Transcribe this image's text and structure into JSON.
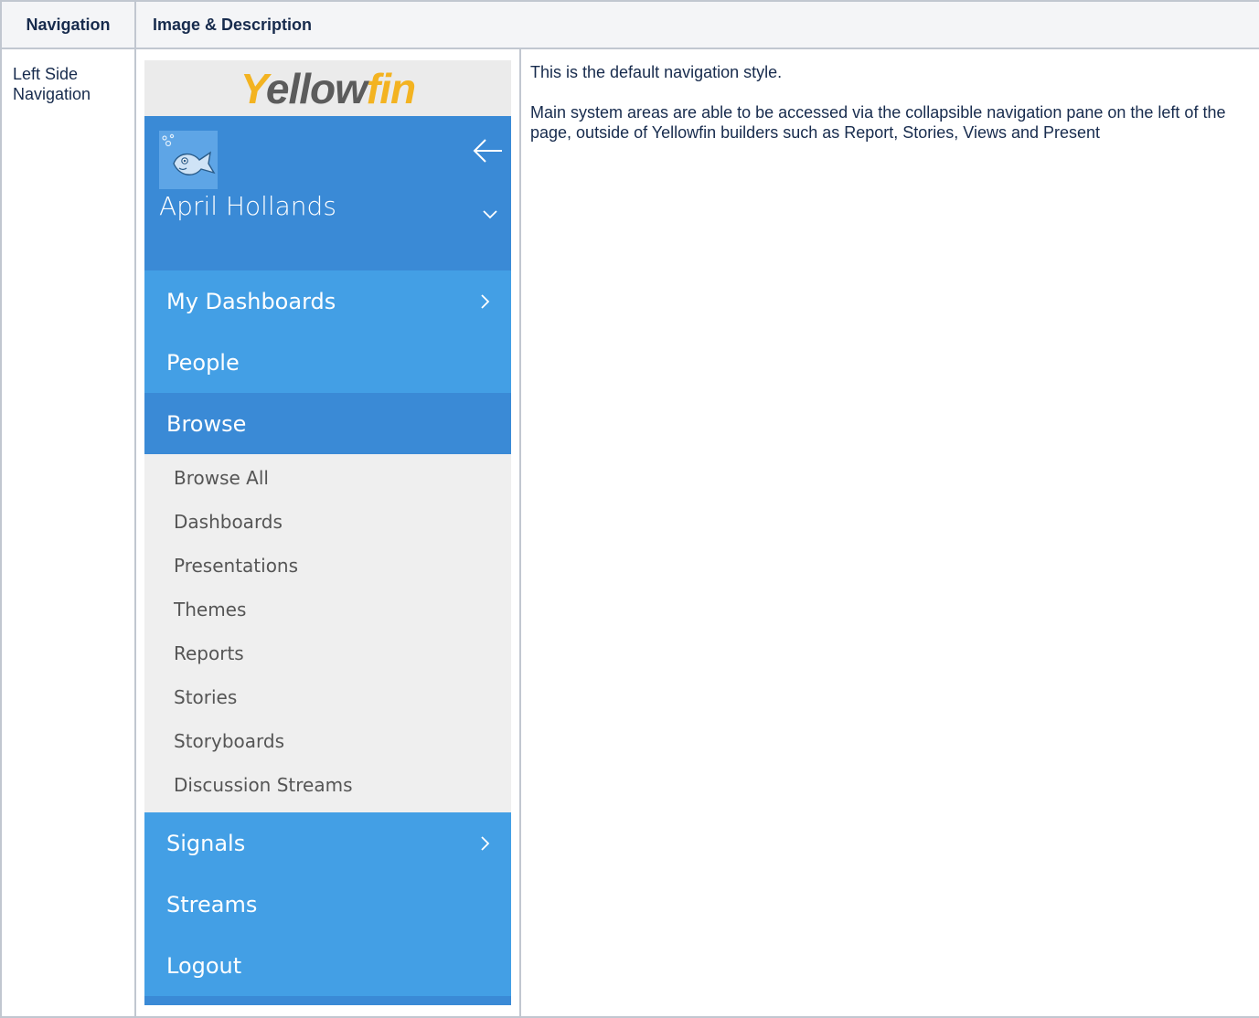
{
  "table": {
    "headers": [
      "Navigation",
      "Image & Description"
    ],
    "row": {
      "nav_label": "Left Side Navigation",
      "description": [
        "This is the default navigation style.",
        "Main system areas are able to be accessed via the collapsible navigation pane on the left of the page, outside of Yellowfin builders such as Report, Stories, Views and Present"
      ]
    }
  },
  "yellowfin_nav": {
    "logo": {
      "part_y": "Y",
      "part_ellow": "ellow",
      "part_fin": "fin"
    },
    "user": {
      "name": "April Hollands",
      "avatar_icon": "fish-avatar-icon"
    },
    "menu": [
      {
        "label": "My Dashboards",
        "chevron": true,
        "active": false
      },
      {
        "label": "People",
        "chevron": false,
        "active": false
      },
      {
        "label": "Browse",
        "chevron": false,
        "active": true
      }
    ],
    "browse_submenu": [
      "Browse All",
      "Dashboards",
      "Presentations",
      "Themes",
      "Reports",
      "Stories",
      "Storyboards",
      "Discussion Streams"
    ],
    "menu_after": [
      {
        "label": "Signals",
        "chevron": true
      },
      {
        "label": "Streams",
        "chevron": false
      },
      {
        "label": "Logout",
        "chevron": false
      }
    ],
    "colors": {
      "item_blue": "#439fe5",
      "active_blue": "#3a8ad6",
      "submenu_bg": "#efefef",
      "logo_yellow": "#f3b321"
    }
  }
}
